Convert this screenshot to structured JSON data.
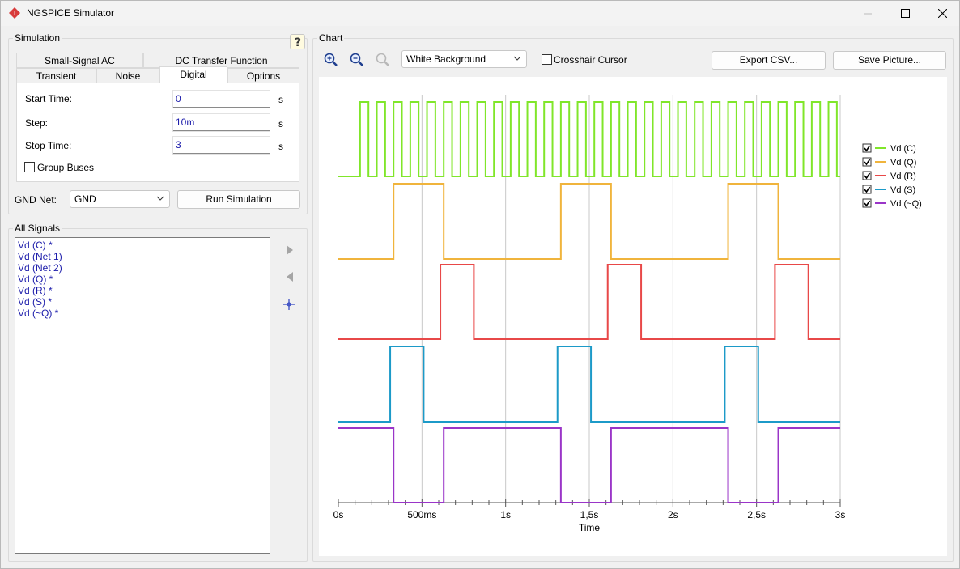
{
  "window": {
    "title": "NGSPICE Simulator"
  },
  "simulation": {
    "group_title": "Simulation",
    "tabs_row1": [
      "Small-Signal AC",
      "DC Transfer Function"
    ],
    "tabs_row2": [
      "Transient",
      "Noise",
      "Digital",
      "Options"
    ],
    "active_tab": "Digital",
    "start_time": {
      "label": "Start Time:",
      "value": "0",
      "unit": "s"
    },
    "step": {
      "label": "Step:",
      "value": "10m",
      "unit": "s"
    },
    "stop_time": {
      "label": "Stop Time:",
      "value": "3",
      "unit": "s"
    },
    "group_buses": {
      "label": "Group Buses",
      "checked": false
    },
    "gnd_net": {
      "label": "GND Net:",
      "value": "GND"
    },
    "run_button": "Run Simulation"
  },
  "signals": {
    "group_title": "All Signals",
    "items": [
      "Vd (C) *",
      "Vd (Net 1)",
      "Vd (Net 2)",
      "Vd (Q) *",
      "Vd (R) *",
      "Vd (S) *",
      "Vd (~Q) *"
    ]
  },
  "chart": {
    "group_title": "Chart",
    "background_option": "White Background",
    "crosshair": {
      "label": "Crosshair Cursor",
      "checked": false
    },
    "export_button": "Export CSV...",
    "save_button": "Save Picture..."
  },
  "chart_data": {
    "type": "line",
    "xlabel": "Time",
    "x_range": [
      0,
      3
    ],
    "x_tick_labels": [
      "0s",
      "500ms",
      "1s",
      "1,5s",
      "2s",
      "2,5s",
      "3s"
    ],
    "x_ticks": [
      0,
      0.5,
      1,
      1.5,
      2,
      2.5,
      3
    ],
    "grid": true,
    "legend_position": "right",
    "series": [
      {
        "name": "Vd (C)",
        "color": "#80e62a",
        "edges": [
          0.13,
          0.18,
          0.23,
          0.28,
          0.33,
          0.38,
          0.43,
          0.48,
          0.53,
          0.58,
          0.63,
          0.68,
          0.73,
          0.78,
          0.83,
          0.88,
          0.93,
          0.98,
          1.03,
          1.08,
          1.13,
          1.18,
          1.23,
          1.28,
          1.33,
          1.38,
          1.43,
          1.48,
          1.53,
          1.58,
          1.63,
          1.68,
          1.73,
          1.78,
          1.83,
          1.88,
          1.93,
          1.98,
          2.03,
          2.08,
          2.13,
          2.18,
          2.23,
          2.28,
          2.33,
          2.38,
          2.43,
          2.48,
          2.53,
          2.58,
          2.63,
          2.68,
          2.73,
          2.78,
          2.83,
          2.88,
          2.93,
          2.98
        ],
        "initial": 0
      },
      {
        "name": "Vd (Q)",
        "color": "#f0b43c",
        "edges": [
          0.33,
          0.63,
          1.33,
          1.63,
          2.33,
          2.63
        ],
        "initial": 0
      },
      {
        "name": "Vd (R)",
        "color": "#e84848",
        "edges": [
          0.61,
          0.81,
          1.61,
          1.81,
          2.61,
          2.81
        ],
        "initial": 0
      },
      {
        "name": "Vd (S)",
        "color": "#1c9ac8",
        "edges": [
          0.31,
          0.51,
          1.31,
          1.51,
          2.31,
          2.51
        ],
        "initial": 0
      },
      {
        "name": "Vd (~Q)",
        "color": "#9a35c8",
        "edges": [
          0.33,
          0.63,
          1.33,
          1.63,
          2.33,
          2.63
        ],
        "initial": 1
      }
    ]
  }
}
